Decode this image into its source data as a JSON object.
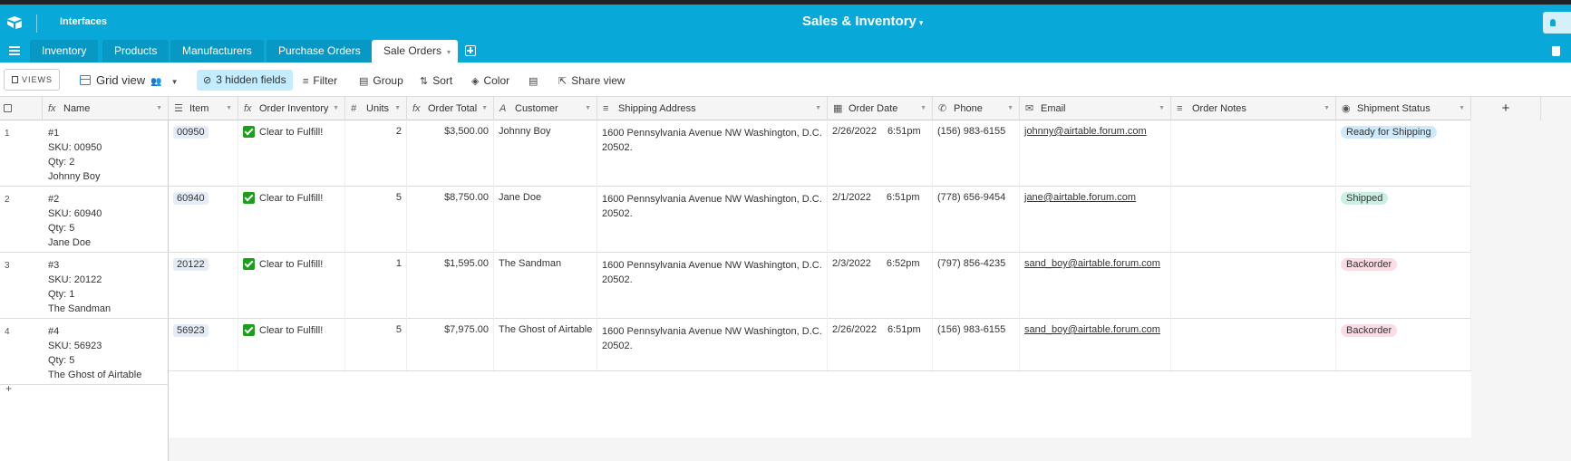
{
  "app": {
    "interfaces_label": "Interfaces",
    "base_title": "Sales & Inventory",
    "title_caret": "▾"
  },
  "tabs": [
    {
      "label": "Inventory"
    },
    {
      "label": "Products"
    },
    {
      "label": "Manufacturers"
    },
    {
      "label": "Purchase Orders"
    },
    {
      "label": "Sale Orders",
      "active": true,
      "caret": "▾"
    }
  ],
  "toolbar": {
    "views_label": "VIEWS",
    "view_name": "Grid view",
    "hidden_fields": "3 hidden fields",
    "filter": "Filter",
    "group": "Group",
    "sort": "Sort",
    "color": "Color",
    "share_view": "Share view"
  },
  "columns": [
    {
      "label": "Name",
      "icon": "fx"
    },
    {
      "label": "Item",
      "icon": "☰"
    },
    {
      "label": "Order Inventory",
      "icon": "fx"
    },
    {
      "label": "Units",
      "icon": "#"
    },
    {
      "label": "Order Total",
      "icon": "fx"
    },
    {
      "label": "Customer",
      "icon": "A"
    },
    {
      "label": "Shipping Address",
      "icon": "≡"
    },
    {
      "label": "Order Date",
      "icon": "▦"
    },
    {
      "label": "Phone",
      "icon": "✆"
    },
    {
      "label": "Email",
      "icon": "✉"
    },
    {
      "label": "Order Notes",
      "icon": "≡"
    },
    {
      "label": "Shipment Status",
      "icon": "◉"
    }
  ],
  "add_column": "+",
  "add_row": "+",
  "rows": [
    {
      "num": "1",
      "name": [
        "#1",
        "SKU: 00950",
        "Qty: 2",
        "Johnny Boy"
      ],
      "item": "00950",
      "order_inventory": "Clear to Fulfill!",
      "units": "2",
      "order_total": "$3,500.00",
      "customer": "Johnny Boy",
      "address": "1600 Pennsylvania Avenue NW Washington, D.C. 20502.",
      "order_date": "2/26/2022",
      "order_time": "6:51pm",
      "phone": "(156) 983-6155",
      "email": "johnny@airtable.forum.com",
      "notes": "",
      "status": "Ready for Shipping",
      "status_color": "#cfe9fb"
    },
    {
      "num": "2",
      "name": [
        "#2",
        "SKU: 60940",
        "Qty: 5",
        "Jane Doe"
      ],
      "item": "60940",
      "order_inventory": "Clear to Fulfill!",
      "units": "5",
      "order_total": "$8,750.00",
      "customer": "Jane Doe",
      "address": "1600 Pennsylvania Avenue NW Washington, D.C. 20502.",
      "order_date": "2/1/2022",
      "order_time": "6:51pm",
      "phone": "(778) 656-9454",
      "email": "jane@airtable.forum.com",
      "notes": "",
      "status": "Shipped",
      "status_color": "#c9f0e2"
    },
    {
      "num": "3",
      "name": [
        "#3",
        "SKU: 20122",
        "Qty: 1",
        "The Sandman"
      ],
      "item": "20122",
      "order_inventory": "Clear to Fulfill!",
      "units": "1",
      "order_total": "$1,595.00",
      "customer": "The Sandman",
      "address": "1600 Pennsylvania Avenue NW Washington, D.C. 20502.",
      "order_date": "2/3/2022",
      "order_time": "6:52pm",
      "phone": "(797) 856-4235",
      "email": "sand_boy@airtable.forum.com",
      "notes": "",
      "status": "Backorder",
      "status_color": "#fbdbe4"
    },
    {
      "num": "4",
      "name": [
        "#4",
        "SKU: 56923",
        "Qty: 5",
        "The Ghost of Airtable"
      ],
      "item": "56923",
      "order_inventory": "Clear to Fulfill!",
      "units": "5",
      "order_total": "$7,975.00",
      "customer": "The Ghost of Airtable",
      "address": "1600 Pennsylvania Avenue NW Washington, D.C. 20502.",
      "order_date": "2/26/2022",
      "order_time": "6:51pm",
      "phone": "(156) 983-6155",
      "email": "sand_boy@airtable.forum.com",
      "notes": "",
      "status": "Backorder",
      "status_color": "#fbdbe4"
    }
  ],
  "colors": {
    "appbar": "#08a8d8",
    "accent_blue": "#2d7ff9",
    "check_green": "#1c9d1c"
  }
}
